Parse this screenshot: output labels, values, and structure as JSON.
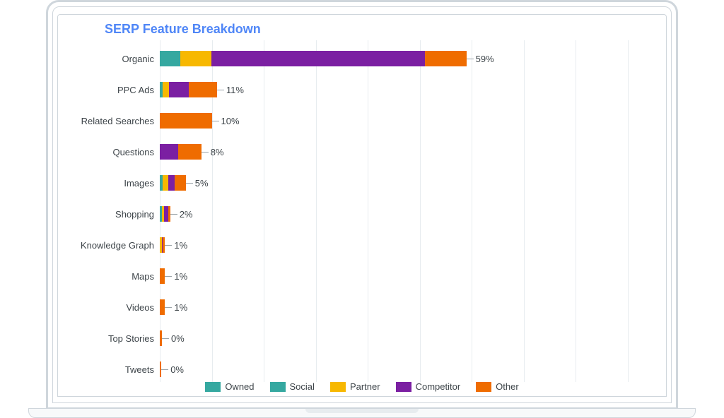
{
  "title": "SERP Feature Breakdown",
  "legend": {
    "owned": "Owned",
    "social": "Social",
    "partner": "Partner",
    "competitor": "Competitor",
    "other": "Other"
  },
  "colors": {
    "owned": "#35a8a0",
    "social": "#35a8a0",
    "partner": "#f7b801",
    "competitor": "#7b1fa2",
    "other": "#ef6c00"
  },
  "chart_data": {
    "type": "bar",
    "orientation": "horizontal",
    "stacked": true,
    "title": "SERP Feature Breakdown",
    "xlabel": "",
    "ylabel": "",
    "xlim": [
      0,
      100
    ],
    "categories": [
      "Organic",
      "PPC Ads",
      "Related Searches",
      "Questions",
      "Images",
      "Shopping",
      "Knowledge Graph",
      "Maps",
      "Videos",
      "Top Stories",
      "Tweets"
    ],
    "totals_label": [
      "59%",
      "11%",
      "10%",
      "8%",
      "5%",
      "2%",
      "1%",
      "1%",
      "1%",
      "0%",
      "0%"
    ],
    "series": [
      {
        "name": "Owned",
        "values": [
          4.0,
          0.6,
          0.0,
          0.0,
          0.6,
          0.4,
          0.0,
          0.0,
          0.0,
          0.0,
          0.0
        ]
      },
      {
        "name": "Social",
        "values": [
          0.0,
          0.0,
          0.0,
          0.0,
          0.0,
          0.0,
          0.0,
          0.0,
          0.0,
          0.0,
          0.0
        ]
      },
      {
        "name": "Partner",
        "values": [
          6.0,
          1.2,
          0.0,
          0.0,
          1.0,
          0.4,
          0.4,
          0.0,
          0.0,
          0.0,
          0.0
        ]
      },
      {
        "name": "Competitor",
        "values": [
          41.0,
          3.8,
          0.0,
          3.5,
          1.2,
          0.8,
          0.2,
          0.0,
          0.0,
          0.0,
          0.0
        ]
      },
      {
        "name": "Other",
        "values": [
          8.0,
          5.4,
          10.0,
          4.5,
          2.2,
          0.4,
          0.4,
          1.0,
          1.0,
          0.4,
          0.3
        ]
      }
    ]
  }
}
